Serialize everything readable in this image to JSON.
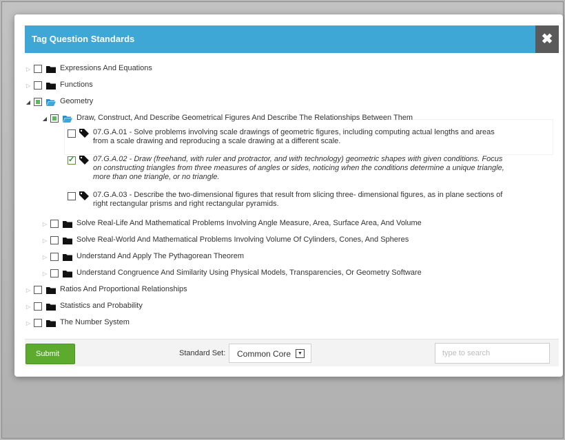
{
  "modal": {
    "title": "Tag Question Standards",
    "close_symbol": "✖"
  },
  "tree": [
    {
      "label": "Expressions And Equations",
      "state": "unchecked",
      "expanded": false
    },
    {
      "label": "Functions",
      "state": "unchecked",
      "expanded": false
    },
    {
      "label": "Geometry",
      "state": "partial",
      "expanded": true
    },
    {
      "label": "Draw, Construct, And Describe Geometrical Figures And Describe The Relationships Between Them",
      "state": "partial",
      "expanded": true
    },
    {
      "code": "07.G.A.01",
      "text": " - Solve problems involving scale drawings of geometric figures, including computing actual lengths and areas from a scale drawing and reproducing a scale drawing at a different scale.",
      "state": "unchecked"
    },
    {
      "code": "07.G.A.02",
      "text": " - Draw (freehand, with ruler and protractor, and with technology) geometric shapes with given conditions. Focus on constructing triangles from three measures of angles or sides, noticing when the conditions determine a unique triangle, more than one triangle, or no triangle.",
      "state": "checked"
    },
    {
      "code": "07.G.A.03",
      "text": " - Describe the two-dimensional figures that result from slicing three- dimensional figures, as in plane sections of right rectangular prisms and right rectangular pyramids.",
      "state": "unchecked"
    },
    {
      "label": "Solve Real-Life And Mathematical Problems Involving Angle Measure, Area, Surface Area, And Volume",
      "state": "unchecked",
      "expanded": false
    },
    {
      "label": "Solve Real-World And Mathematical Problems Involving Volume Of Cylinders, Cones, And Spheres",
      "state": "unchecked",
      "expanded": false
    },
    {
      "label": "Understand And Apply The Pythagorean Theorem",
      "state": "unchecked",
      "expanded": false
    },
    {
      "label": "Understand Congruence And Similarity Using Physical Models, Transparencies, Or Geometry Software",
      "state": "unchecked",
      "expanded": false
    },
    {
      "label": "Ratios And Proportional Relationships",
      "state": "unchecked",
      "expanded": false
    },
    {
      "label": "Statistics and Probability",
      "state": "unchecked",
      "expanded": false
    },
    {
      "label": "The Number System",
      "state": "unchecked",
      "expanded": false
    }
  ],
  "footer": {
    "submit_label": "Submit",
    "standard_set_label": "Standard Set:",
    "standard_set_value": "Common Core",
    "search_placeholder": "type to search"
  },
  "colors": {
    "header": "#3ea7d6",
    "submit": "#5cab2e",
    "close": "#5a5a5a"
  }
}
